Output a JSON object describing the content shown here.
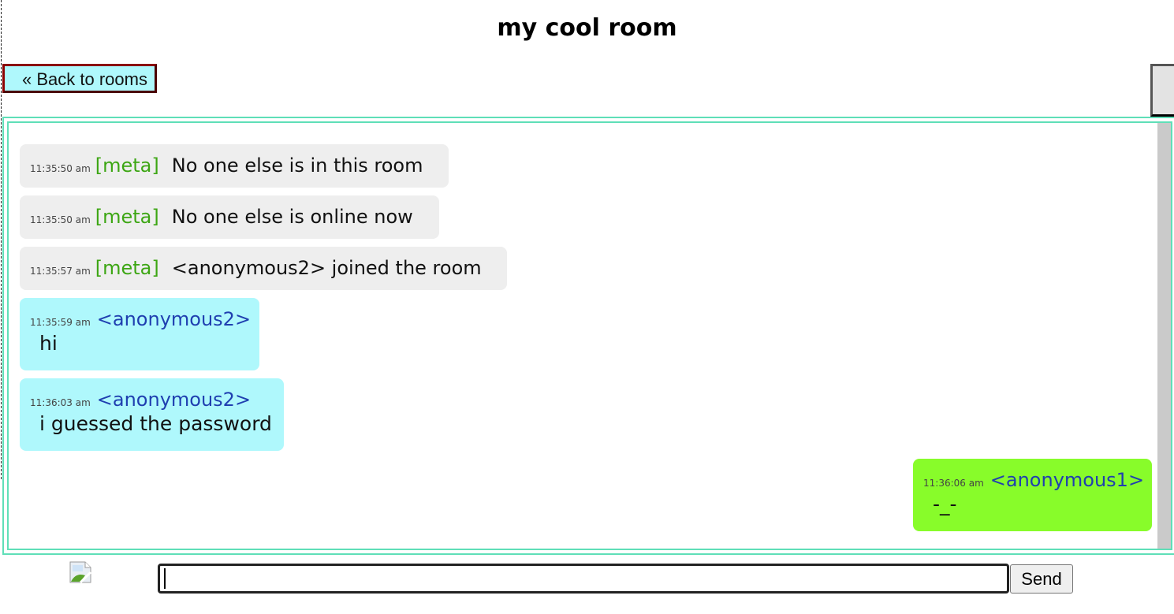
{
  "room": {
    "title": "my cool room"
  },
  "nav": {
    "back_label": "« Back to rooms"
  },
  "messages": [
    {
      "type": "meta",
      "time": "11:35:50 am",
      "tag": "[meta]",
      "text": "No one else is in this room"
    },
    {
      "type": "meta",
      "time": "11:35:50 am",
      "tag": "[meta]",
      "text": "No one else is online now"
    },
    {
      "type": "meta",
      "time": "11:35:57 am",
      "tag": "[meta]",
      "text": "<anonymous2> joined the room"
    },
    {
      "type": "other",
      "time": "11:35:59 am",
      "user": "<anonymous2>",
      "text": "hi"
    },
    {
      "type": "other",
      "time": "11:36:03 am",
      "user": "<anonymous2>",
      "text": "i guessed the password"
    },
    {
      "type": "self",
      "time": "11:36:06 am",
      "user": "<anonymous1>",
      "text": "-_-"
    }
  ],
  "composer": {
    "value": "",
    "placeholder": "",
    "send_label": "Send",
    "avatar_icon": "broken-image-icon"
  },
  "colors": {
    "meta_tag": "#3da614",
    "username": "#1f3fb0",
    "meta_bubble": "#eeeeee",
    "other_bubble": "#aff8fc",
    "self_bubble": "#88fc2a",
    "chat_border": "#5fdfb8",
    "back_border": "#8b0000"
  }
}
